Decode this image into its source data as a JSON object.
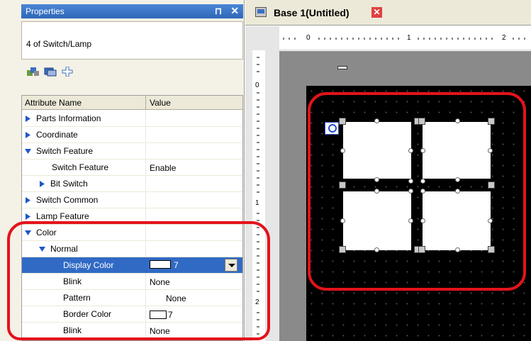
{
  "properties_panel": {
    "title": "Properties",
    "pin_glyph": "⊓",
    "close_glyph": "✕",
    "selection": "4 of Switch/Lamp",
    "grid_header": {
      "name": "Attribute Name",
      "value": "Value"
    },
    "rows": [
      {
        "name": "Parts Information",
        "value": ""
      },
      {
        "name": "Coordinate",
        "value": ""
      },
      {
        "name": "Switch Feature",
        "value": ""
      },
      {
        "name": "Switch Feature",
        "value": "Enable"
      },
      {
        "name": "Bit Switch",
        "value": ""
      },
      {
        "name": "Switch Common",
        "value": ""
      },
      {
        "name": "Lamp Feature",
        "value": ""
      },
      {
        "name": "Color",
        "value": ""
      },
      {
        "name": "Normal",
        "value": ""
      },
      {
        "name": "Display Color",
        "value": "7"
      },
      {
        "name": "Blink",
        "value": "None"
      },
      {
        "name": "Pattern",
        "value": "None"
      },
      {
        "name": "Border Color",
        "value": "7"
      },
      {
        "name": "Blink",
        "value": "None"
      }
    ]
  },
  "editor": {
    "tab_title": "Base 1(Untitled)",
    "tab_close": "✕",
    "ruler_top_labels": [
      "0",
      "1",
      "2"
    ],
    "ruler_left_labels": [
      "0",
      "1",
      "2"
    ]
  },
  "colors": {
    "title_blue": "#2f66b8",
    "selection_blue": "#316ac5",
    "highlight_red": "#e3131b",
    "screen_black": "#000000"
  },
  "icons": [
    "pin-icon",
    "close-icon",
    "arrange-icon",
    "layer-icon",
    "move-icon",
    "expand-triangle-icon",
    "collapse-triangle-icon",
    "dropdown-arrow-icon",
    "window-icon",
    "tab-close-icon",
    "magnifier-icon"
  ]
}
